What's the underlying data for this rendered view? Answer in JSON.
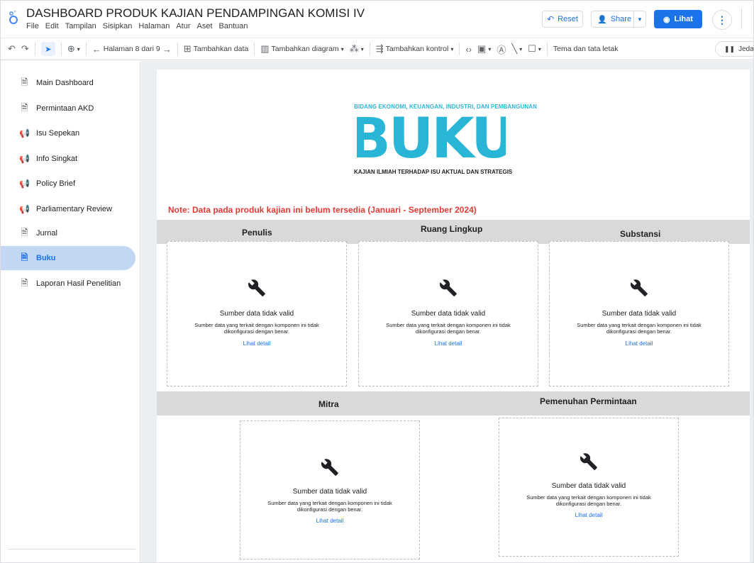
{
  "app": {
    "title": "DASHBOARD PRODUK KAJIAN PENDAMPINGAN KOMISI IV",
    "menu": [
      "File",
      "Edit",
      "Tampilan",
      "Sisipkan",
      "Halaman",
      "Atur",
      "Aset",
      "Bantuan"
    ],
    "buttons": {
      "reset": "Reset",
      "share": "Share",
      "view": "Lihat"
    }
  },
  "toolbar": {
    "page_nav": "Halaman 8 dari 9",
    "add_data": "Tambahkan data",
    "add_chart": "Tambahkan diagram",
    "add_control": "Tambahkan kontrol",
    "theme": "Tema dan tata letak",
    "pause": "Jeda"
  },
  "sidebar": {
    "items": [
      {
        "label": "Main Dashboard",
        "icon": "document-icon",
        "active": false
      },
      {
        "label": "Permintaan AKD",
        "icon": "document-icon",
        "active": false
      },
      {
        "label": "Isu Sepekan",
        "icon": "megaphone-icon",
        "active": false
      },
      {
        "label": "Info Singkat",
        "icon": "megaphone-icon",
        "active": false
      },
      {
        "label": "Policy Brief",
        "icon": "megaphone-icon",
        "active": false
      },
      {
        "label": "Parliamentary Review",
        "icon": "megaphone-icon",
        "active": false
      },
      {
        "label": "Jurnal",
        "icon": "document-icon",
        "active": false
      },
      {
        "label": "Buku",
        "icon": "document-icon",
        "active": true
      },
      {
        "label": "Laporan Hasil Penelitian",
        "icon": "document-icon",
        "active": false
      }
    ]
  },
  "report": {
    "header_top": "BIDANG EKONOMI, KEUANGAN, INDUSTRI, DAN PEMBANGUNAN",
    "logo_text": "BUKU",
    "header_bottom": "KAJIAN ILMIAH TERHADAP ISU AKTUAL DAN STRATEGIS",
    "note": "Note: Data pada produk kajian ini belum tersedia (Januari - September 2024)",
    "sections_row1": [
      "Penulis",
      "Ruang Lingkup",
      "Substansi"
    ],
    "sections_row2": [
      "Mitra",
      "Pemenuhan Permintaan"
    ],
    "error": {
      "title": "Sumber data tidak valid",
      "description": "Sumber data yang terkait dengan komponen ini tidak dikonfigurasi dengan benar.",
      "link": "Lihat detail"
    }
  },
  "colors": {
    "accent": "#1a73e8",
    "active_nav_bg": "#c2d7f4",
    "logo_cyan": "#29b6d6",
    "note_red": "#e53935",
    "band_gray": "#d9d9d9"
  }
}
